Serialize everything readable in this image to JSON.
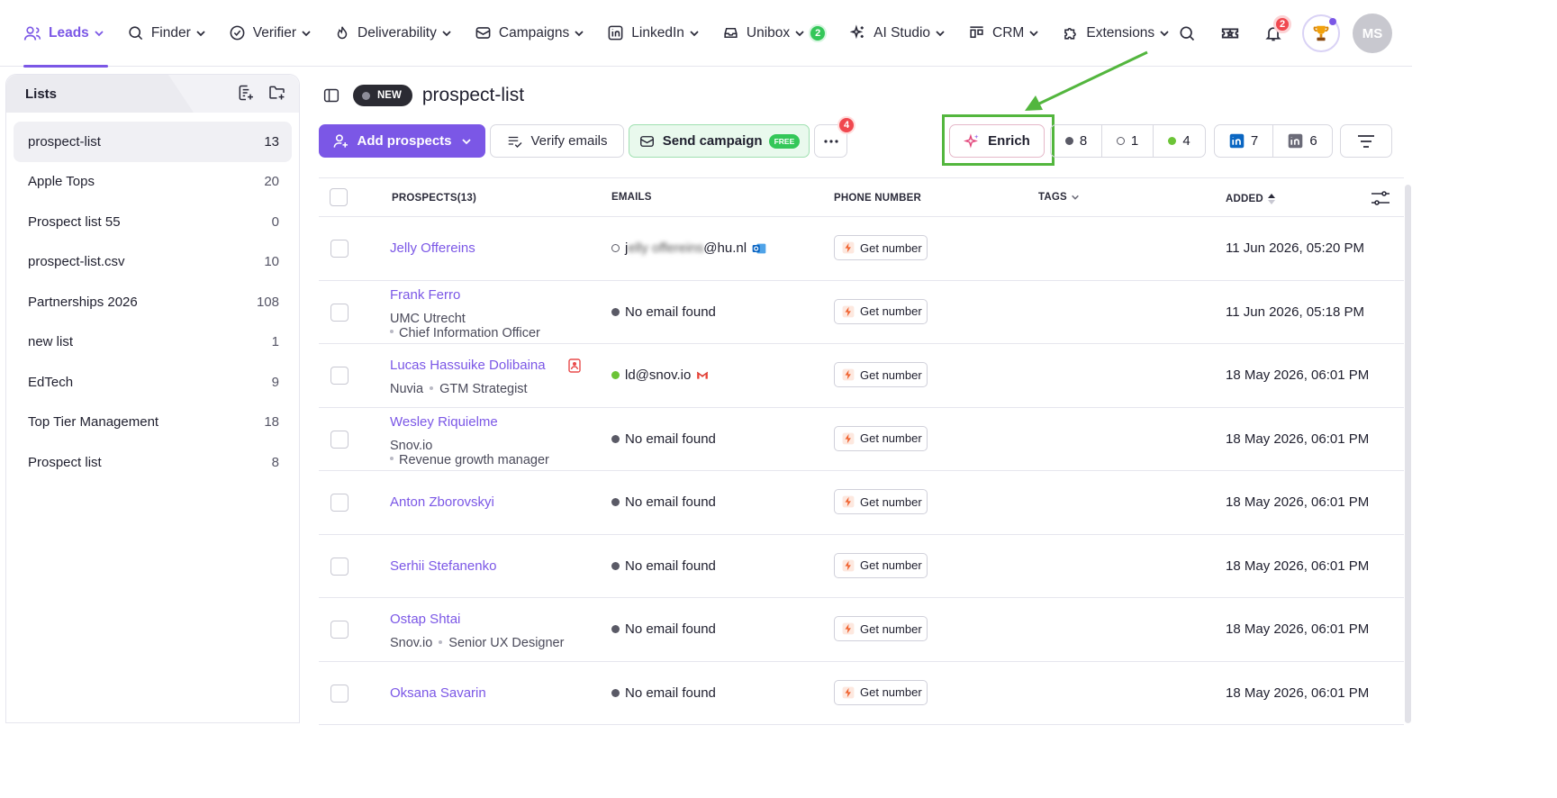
{
  "nav": {
    "items": [
      {
        "label": "Leads",
        "icon": "users-icon",
        "active": true
      },
      {
        "label": "Finder",
        "icon": "search-icon"
      },
      {
        "label": "Verifier",
        "icon": "check-circle-icon"
      },
      {
        "label": "Deliverability",
        "icon": "flame-icon"
      },
      {
        "label": "Campaigns",
        "icon": "envelope-icon"
      },
      {
        "label": "LinkedIn",
        "icon": "linkedin-icon"
      },
      {
        "label": "Unibox",
        "icon": "inbox-icon",
        "badge": "2"
      },
      {
        "label": "AI Studio",
        "icon": "sparkles-icon"
      },
      {
        "label": "CRM",
        "icon": "kanban-icon"
      },
      {
        "label": "Extensions",
        "icon": "puzzle-icon"
      }
    ],
    "notifications_count": "2",
    "avatar_initials": "MS"
  },
  "sidebar": {
    "title": "Lists",
    "lists": [
      {
        "name": "prospect-list",
        "count": "13",
        "active": true
      },
      {
        "name": "Apple Tops",
        "count": "20"
      },
      {
        "name": "Prospect list 55",
        "count": "0"
      },
      {
        "name": "prospect-list.csv",
        "count": "10"
      },
      {
        "name": "Partnerships 2026",
        "count": "108"
      },
      {
        "name": "new list",
        "count": "1"
      },
      {
        "name": "EdTech",
        "count": "9"
      },
      {
        "name": "Top Tier Management",
        "count": "18"
      },
      {
        "name": "Prospect list",
        "count": "8"
      }
    ]
  },
  "header": {
    "badge": "NEW",
    "title": "prospect-list"
  },
  "toolbar": {
    "add_prospects": "Add prospects",
    "verify_emails": "Verify emails",
    "send_campaign": "Send campaign",
    "free_tag": "FREE",
    "more_badge": "4",
    "enrich": "Enrich",
    "status_counts": {
      "unverified": "8",
      "empty": "1",
      "valid": "4"
    },
    "linkedin_counts": {
      "a": "7",
      "b": "6"
    }
  },
  "table": {
    "columns": {
      "prospects": "PROSPECTS(13)",
      "emails": "EMAILS",
      "phone": "PHONE NUMBER",
      "tags": "TAGS",
      "added": "ADDED"
    },
    "get_number_label": "Get number",
    "rows": [
      {
        "name": "Jelly Offereins",
        "company": "",
        "title": "",
        "email": "jellyoffereins@hu.nl",
        "email_status": "empty",
        "email_client": "outlook-icon",
        "email_blur": "elly offereins",
        "added": "11 Jun 2026, 05:20 PM"
      },
      {
        "name": "Frank Ferro",
        "company": "UMC Utrecht",
        "title": "Chief Information Officer",
        "email": "No email found",
        "email_status": "dark",
        "added": "11 Jun 2026, 05:18 PM",
        "title_below": true
      },
      {
        "name": "Lucas Hassuike Dolibaina",
        "company": "Nuvia",
        "title": "GTM Strategist",
        "email": "ld@snov.io",
        "email_status": "green",
        "email_client": "gmail-icon",
        "added": "18 May 2026, 06:01 PM",
        "contact_icon": true
      },
      {
        "name": "Wesley Riquielme",
        "company": "Snov.io",
        "title": "Revenue growth manager",
        "email": "No email found",
        "email_status": "dark",
        "added": "18 May 2026, 06:01 PM",
        "title_below": true
      },
      {
        "name": "Anton Zborovskyi",
        "company": "",
        "title": "",
        "email": "No email found",
        "email_status": "dark",
        "added": "18 May 2026, 06:01 PM"
      },
      {
        "name": "Serhii Stefanenko",
        "company": "",
        "title": "",
        "email": "No email found",
        "email_status": "dark",
        "added": "18 May 2026, 06:01 PM"
      },
      {
        "name": "Ostap Shtai",
        "company": "Snov.io",
        "title": "Senior UX Designer",
        "email": "No email found",
        "email_status": "dark",
        "added": "18 May 2026, 06:01 PM"
      },
      {
        "name": "Oksana Savarin",
        "company": "",
        "title": "",
        "email": "No email found",
        "email_status": "dark",
        "added": "18 May 2026, 06:01 PM"
      }
    ]
  },
  "colors": {
    "accent": "#7b57e6",
    "highlight": "#53b63e",
    "green": "#34c759",
    "red": "#f0484f"
  }
}
